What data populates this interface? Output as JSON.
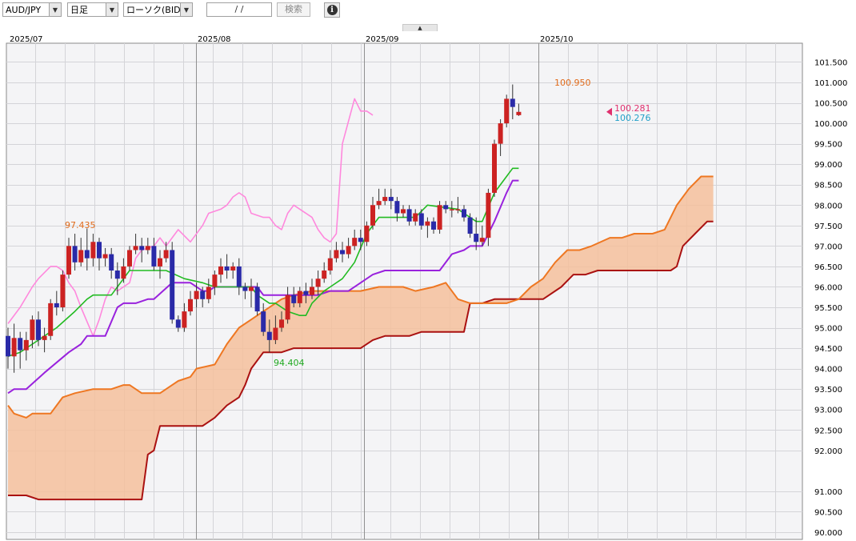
{
  "toolbar": {
    "pair": "AUD/JPY",
    "timeframe": "日足",
    "price_type": "ローソク(BID)",
    "date_value": "/ /",
    "search_label": "検索",
    "info_icon": "info-icon"
  },
  "colors": {
    "up": "#cc2222",
    "down": "#2a2aa8",
    "tenkan": "#22bb22",
    "kijun": "#9922dd",
    "chikou": "#ff88dd",
    "span_a": "#ee7722",
    "span_b": "#aa1111",
    "cloud": "#f4bf9c",
    "last_price": "#e0306e",
    "ask_price": "#22a0c8"
  },
  "chart_data": {
    "type": "candlestick",
    "x_labels": [
      "2025/07",
      "2025/08",
      "2025/09",
      "2025/10"
    ],
    "y_ticks": [
      "101.500",
      "101.000",
      "100.500",
      "100.000",
      "99.500",
      "99.000",
      "98.500",
      "98.000",
      "97.500",
      "97.000",
      "96.500",
      "96.000",
      "95.500",
      "95.000",
      "94.500",
      "94.000",
      "93.500",
      "93.000",
      "92.500",
      "92.000",
      "91.000",
      "90.500",
      "90.000"
    ],
    "ylim": [
      89.95,
      101.95
    ],
    "annotations": {
      "high_1": "97.435",
      "low_1": "94.404",
      "high_2": "100.950",
      "last": "100.281",
      "ask": "100.276"
    },
    "candles": [
      [
        94.8,
        94.3,
        95.0,
        94.0
      ],
      [
        94.3,
        94.75,
        95.1,
        93.9
      ],
      [
        94.75,
        94.45,
        94.9,
        94.0
      ],
      [
        94.45,
        94.7,
        94.9,
        94.2
      ],
      [
        94.7,
        95.2,
        95.3,
        94.5
      ],
      [
        95.2,
        94.7,
        95.4,
        94.55
      ],
      [
        94.7,
        94.8,
        95.0,
        94.4
      ],
      [
        94.8,
        95.6,
        95.7,
        94.7
      ],
      [
        95.6,
        95.5,
        95.9,
        95.3
      ],
      [
        95.5,
        96.3,
        96.4,
        95.4
      ],
      [
        96.3,
        97.0,
        97.2,
        96.2
      ],
      [
        97.0,
        96.6,
        97.3,
        96.4
      ],
      [
        96.6,
        96.9,
        97.2,
        96.5
      ],
      [
        96.9,
        96.7,
        97.43,
        96.4
      ],
      [
        96.7,
        97.1,
        97.3,
        96.5
      ],
      [
        97.1,
        96.7,
        97.2,
        96.4
      ],
      [
        96.7,
        96.8,
        96.95,
        96.5
      ],
      [
        96.8,
        96.4,
        96.95,
        96.2
      ],
      [
        96.4,
        96.2,
        96.6,
        95.8
      ],
      [
        96.2,
        96.5,
        96.7,
        96.1
      ],
      [
        96.5,
        96.9,
        97.0,
        96.4
      ],
      [
        96.9,
        97.0,
        97.3,
        96.8
      ],
      [
        97.0,
        96.9,
        97.2,
        96.6
      ],
      [
        96.9,
        97.0,
        97.2,
        96.8
      ],
      [
        97.0,
        96.5,
        97.2,
        96.4
      ],
      [
        96.5,
        96.7,
        96.9,
        96.2
      ],
      [
        96.7,
        96.9,
        97.1,
        96.6
      ],
      [
        96.9,
        95.2,
        97.1,
        95.1
      ],
      [
        95.2,
        95.0,
        95.3,
        94.9
      ],
      [
        95.0,
        95.4,
        95.6,
        94.9
      ],
      [
        95.4,
        95.7,
        95.9,
        95.3
      ],
      [
        95.7,
        95.9,
        96.1,
        95.5
      ],
      [
        95.9,
        95.7,
        96.0,
        95.5
      ],
      [
        95.7,
        96.0,
        96.2,
        95.6
      ],
      [
        96.0,
        96.3,
        96.4,
        95.8
      ],
      [
        96.3,
        96.5,
        96.7,
        96.1
      ],
      [
        96.5,
        96.4,
        96.8,
        96.2
      ],
      [
        96.4,
        96.5,
        96.6,
        96.2
      ],
      [
        96.5,
        96.0,
        96.7,
        95.8
      ],
      [
        96.0,
        95.9,
        96.1,
        95.7
      ],
      [
        95.9,
        96.0,
        96.2,
        95.5
      ],
      [
        96.0,
        95.4,
        96.1,
        95.3
      ],
      [
        95.4,
        94.9,
        95.6,
        94.8
      ],
      [
        94.9,
        94.7,
        95.2,
        94.4
      ],
      [
        94.7,
        95.0,
        95.3,
        94.6
      ],
      [
        95.0,
        95.2,
        95.4,
        94.9
      ],
      [
        95.2,
        95.8,
        96.0,
        95.1
      ],
      [
        95.8,
        95.6,
        96.0,
        95.5
      ],
      [
        95.6,
        95.9,
        96.0,
        95.5
      ],
      [
        95.9,
        95.8,
        96.1,
        95.6
      ],
      [
        95.8,
        96.0,
        96.2,
        95.7
      ],
      [
        96.0,
        96.2,
        96.4,
        95.8
      ],
      [
        96.2,
        96.4,
        96.6,
        96.1
      ],
      [
        96.4,
        96.7,
        96.9,
        96.3
      ],
      [
        96.7,
        96.9,
        97.1,
        96.6
      ],
      [
        96.9,
        96.8,
        97.1,
        96.6
      ],
      [
        96.8,
        97.0,
        97.2,
        96.7
      ],
      [
        97.0,
        97.2,
        97.4,
        96.9
      ],
      [
        97.2,
        97.1,
        97.4,
        96.9
      ],
      [
        97.1,
        97.5,
        97.6,
        97.0
      ],
      [
        97.5,
        98.0,
        98.2,
        97.4
      ],
      [
        98.0,
        98.1,
        98.4,
        97.9
      ],
      [
        98.1,
        98.2,
        98.4,
        98.0
      ],
      [
        98.2,
        98.1,
        98.4,
        97.9
      ],
      [
        98.1,
        97.8,
        98.2,
        97.6
      ],
      [
        97.8,
        97.9,
        98.0,
        97.7
      ],
      [
        97.9,
        97.6,
        98.0,
        97.5
      ],
      [
        97.6,
        97.8,
        97.9,
        97.5
      ],
      [
        97.8,
        97.5,
        97.9,
        97.4
      ],
      [
        97.5,
        97.6,
        97.7,
        97.2
      ],
      [
        97.6,
        97.4,
        97.7,
        97.3
      ],
      [
        97.4,
        98.0,
        98.1,
        97.3
      ],
      [
        98.0,
        97.9,
        98.1,
        97.8
      ],
      [
        97.9,
        97.9,
        98.1,
        97.7
      ],
      [
        97.9,
        97.9,
        98.2,
        97.8
      ],
      [
        97.9,
        97.7,
        98.0,
        97.6
      ],
      [
        97.7,
        97.3,
        97.8,
        97.2
      ],
      [
        97.3,
        97.1,
        97.7,
        96.9
      ],
      [
        97.1,
        97.2,
        97.5,
        97.0
      ],
      [
        97.2,
        98.3,
        98.4,
        97.0
      ],
      [
        98.3,
        99.5,
        99.6,
        98.2
      ],
      [
        99.5,
        100.0,
        100.1,
        99.2
      ],
      [
        100.0,
        100.6,
        100.7,
        99.9
      ],
      [
        100.6,
        100.4,
        100.95,
        100.1
      ],
      [
        100.2,
        100.28,
        100.48,
        100.18
      ]
    ],
    "tenkan": [
      [
        0,
        94.3
      ],
      [
        2,
        94.4
      ],
      [
        4,
        94.6
      ],
      [
        5,
        94.7
      ],
      [
        8,
        95.0
      ],
      [
        11,
        95.4
      ],
      [
        13,
        95.7
      ],
      [
        14,
        95.8
      ],
      [
        17,
        95.8
      ],
      [
        19,
        96.2
      ],
      [
        20,
        96.4
      ],
      [
        26,
        96.4
      ],
      [
        29,
        96.2
      ],
      [
        32,
        96.1
      ],
      [
        34,
        96.0
      ],
      [
        38,
        96.0
      ],
      [
        40,
        96.0
      ],
      [
        41,
        95.8
      ],
      [
        43,
        95.6
      ],
      [
        44,
        95.6
      ],
      [
        46,
        95.4
      ],
      [
        48,
        95.3
      ],
      [
        49,
        95.3
      ],
      [
        50,
        95.6
      ],
      [
        52,
        95.9
      ],
      [
        53,
        96.0
      ],
      [
        55,
        96.2
      ],
      [
        57,
        96.6
      ],
      [
        59,
        97.3
      ],
      [
        61,
        97.7
      ],
      [
        62,
        97.7
      ],
      [
        67,
        97.7
      ],
      [
        69,
        98.0
      ],
      [
        74,
        97.9
      ],
      [
        75,
        97.8
      ],
      [
        77,
        97.6
      ],
      [
        78,
        97.6
      ],
      [
        80,
        98.3
      ],
      [
        83,
        98.9
      ],
      [
        84,
        98.9
      ]
    ],
    "kijun": [
      [
        0,
        93.4
      ],
      [
        1,
        93.5
      ],
      [
        3,
        93.5
      ],
      [
        6,
        93.9
      ],
      [
        10,
        94.4
      ],
      [
        12,
        94.6
      ],
      [
        13,
        94.8
      ],
      [
        16,
        94.8
      ],
      [
        18,
        95.5
      ],
      [
        19,
        95.6
      ],
      [
        21,
        95.6
      ],
      [
        23,
        95.7
      ],
      [
        24,
        95.7
      ],
      [
        27,
        96.1
      ],
      [
        30,
        96.1
      ],
      [
        32,
        95.9
      ],
      [
        33,
        95.9
      ],
      [
        34,
        96.0
      ],
      [
        35,
        96.0
      ],
      [
        39,
        96.0
      ],
      [
        41,
        96.0
      ],
      [
        42,
        95.8
      ],
      [
        49,
        95.8
      ],
      [
        51,
        95.8
      ],
      [
        53,
        95.9
      ],
      [
        56,
        95.9
      ],
      [
        58,
        96.1
      ],
      [
        60,
        96.3
      ],
      [
        62,
        96.4
      ],
      [
        71,
        96.4
      ],
      [
        73,
        96.8
      ],
      [
        75,
        96.9
      ],
      [
        76,
        97.0
      ],
      [
        78,
        97.0
      ],
      [
        80,
        97.6
      ],
      [
        82,
        98.3
      ],
      [
        83,
        98.6
      ],
      [
        84,
        98.6
      ]
    ],
    "chikou": [
      [
        0,
        95.1
      ],
      [
        2,
        95.5
      ],
      [
        4,
        96.0
      ],
      [
        5,
        96.2
      ],
      [
        7,
        96.5
      ],
      [
        8,
        96.5
      ],
      [
        9,
        96.4
      ],
      [
        10,
        96.1
      ],
      [
        11,
        95.9
      ],
      [
        12,
        95.5
      ],
      [
        14,
        94.8
      ],
      [
        15,
        95.2
      ],
      [
        16,
        95.7
      ],
      [
        17,
        96.0
      ],
      [
        18,
        95.9
      ],
      [
        20,
        96.1
      ],
      [
        21,
        96.7
      ],
      [
        22,
        96.9
      ],
      [
        24,
        97.0
      ],
      [
        25,
        97.2
      ],
      [
        26,
        97.0
      ],
      [
        27,
        97.2
      ],
      [
        28,
        97.4
      ],
      [
        30,
        97.1
      ],
      [
        32,
        97.5
      ],
      [
        33,
        97.8
      ],
      [
        35,
        97.9
      ],
      [
        36,
        98.0
      ],
      [
        37,
        98.2
      ],
      [
        38,
        98.3
      ],
      [
        39,
        98.2
      ],
      [
        40,
        97.8
      ],
      [
        42,
        97.7
      ],
      [
        43,
        97.7
      ],
      [
        44,
        97.5
      ],
      [
        45,
        97.4
      ],
      [
        46,
        97.8
      ],
      [
        47,
        98.0
      ],
      [
        48,
        97.9
      ],
      [
        50,
        97.7
      ],
      [
        51,
        97.4
      ],
      [
        52,
        97.2
      ],
      [
        53,
        97.1
      ],
      [
        54,
        97.3
      ],
      [
        55,
        99.5
      ],
      [
        57,
        100.6
      ],
      [
        58,
        100.3
      ],
      [
        59,
        100.3
      ],
      [
        60,
        100.2
      ]
    ],
    "span_a": [
      [
        0,
        93.1
      ],
      [
        1,
        92.9
      ],
      [
        3,
        92.8
      ],
      [
        4,
        92.9
      ],
      [
        6,
        92.9
      ],
      [
        7,
        92.9
      ],
      [
        9,
        93.3
      ],
      [
        11,
        93.4
      ],
      [
        14,
        93.5
      ],
      [
        17,
        93.5
      ],
      [
        19,
        93.6
      ],
      [
        20,
        93.6
      ],
      [
        22,
        93.4
      ],
      [
        25,
        93.4
      ],
      [
        27,
        93.6
      ],
      [
        28,
        93.7
      ],
      [
        30,
        93.8
      ],
      [
        31,
        94.0
      ],
      [
        34,
        94.1
      ],
      [
        36,
        94.6
      ],
      [
        38,
        95.0
      ],
      [
        40,
        95.2
      ],
      [
        42,
        95.4
      ],
      [
        45,
        95.7
      ],
      [
        47,
        95.8
      ],
      [
        50,
        95.9
      ],
      [
        54,
        95.9
      ],
      [
        58,
        95.9
      ],
      [
        61,
        96.0
      ],
      [
        63,
        96.0
      ],
      [
        65,
        96.0
      ],
      [
        67,
        95.9
      ],
      [
        70,
        96.0
      ],
      [
        72,
        96.1
      ],
      [
        74,
        95.7
      ],
      [
        76,
        95.6
      ],
      [
        80,
        95.6
      ],
      [
        82,
        95.6
      ],
      [
        84,
        95.7
      ],
      [
        86,
        96.0
      ],
      [
        88,
        96.2
      ],
      [
        90,
        96.6
      ],
      [
        92,
        96.9
      ],
      [
        94,
        96.9
      ],
      [
        96,
        97.0
      ],
      [
        99,
        97.2
      ],
      [
        101,
        97.2
      ],
      [
        103,
        97.3
      ],
      [
        106,
        97.3
      ],
      [
        108,
        97.4
      ],
      [
        110,
        98.0
      ],
      [
        112,
        98.4
      ],
      [
        114,
        98.7
      ],
      [
        116,
        98.7
      ]
    ],
    "span_b": [
      [
        0,
        90.9
      ],
      [
        1,
        90.9
      ],
      [
        3,
        90.9
      ],
      [
        5,
        90.8
      ],
      [
        10,
        90.8
      ],
      [
        14,
        90.8
      ],
      [
        20,
        90.8
      ],
      [
        22,
        90.8
      ],
      [
        23,
        91.9
      ],
      [
        24,
        92.0
      ],
      [
        25,
        92.6
      ],
      [
        27,
        92.6
      ],
      [
        30,
        92.6
      ],
      [
        32,
        92.6
      ],
      [
        34,
        92.8
      ],
      [
        36,
        93.1
      ],
      [
        38,
        93.3
      ],
      [
        39,
        93.6
      ],
      [
        40,
        94.0
      ],
      [
        42,
        94.4
      ],
      [
        45,
        94.4
      ],
      [
        47,
        94.5
      ],
      [
        49,
        94.5
      ],
      [
        55,
        94.5
      ],
      [
        58,
        94.5
      ],
      [
        60,
        94.7
      ],
      [
        62,
        94.8
      ],
      [
        64,
        94.8
      ],
      [
        66,
        94.8
      ],
      [
        68,
        94.9
      ],
      [
        71,
        94.9
      ],
      [
        73,
        94.9
      ],
      [
        75,
        94.9
      ],
      [
        76,
        95.6
      ],
      [
        78,
        95.6
      ],
      [
        80,
        95.7
      ],
      [
        82,
        95.7
      ],
      [
        84,
        95.7
      ],
      [
        88,
        95.7
      ],
      [
        91,
        96.0
      ],
      [
        93,
        96.3
      ],
      [
        95,
        96.3
      ],
      [
        97,
        96.4
      ],
      [
        100,
        96.4
      ],
      [
        106,
        96.4
      ],
      [
        109,
        96.4
      ],
      [
        110,
        96.5
      ],
      [
        111,
        97.0
      ],
      [
        113,
        97.3
      ],
      [
        115,
        97.6
      ],
      [
        116,
        97.6
      ]
    ]
  }
}
